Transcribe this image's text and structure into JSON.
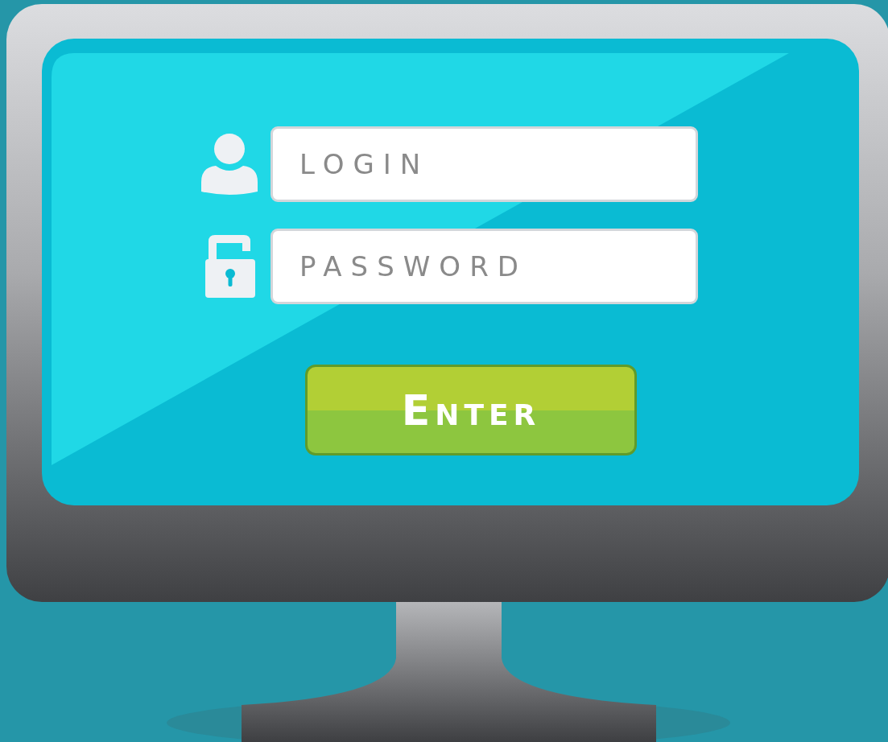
{
  "login_field": {
    "placeholder": "LOGIN"
  },
  "password_field": {
    "placeholder": "PASSWORD"
  },
  "enter_button": {
    "label": "Enter"
  }
}
